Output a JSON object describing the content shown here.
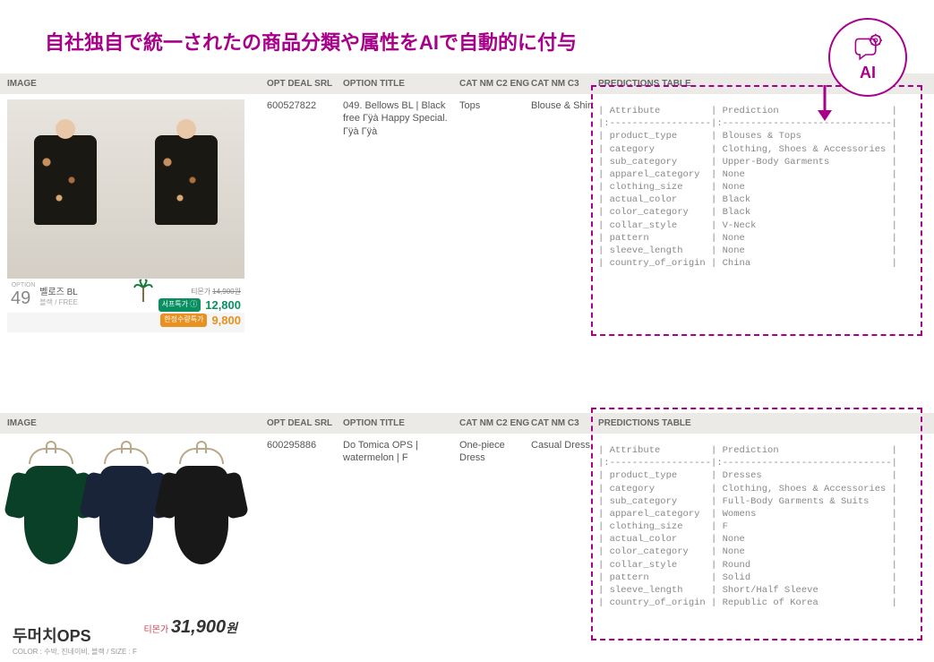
{
  "headline": "自社独自で統一されたの商品分類や属性をAIで自動的に付与",
  "ai_badge": {
    "label": "AI"
  },
  "columns": {
    "image": "IMAGE",
    "opt_deal_srl": "OPT DEAL SRL",
    "option_title": "OPTION TITLE",
    "cat_nm_c2_eng": "CAT NM C2 ENG",
    "cat_nm_c3": "CAT NM C3",
    "predictions_table": "PREDICTIONS TABLE"
  },
  "rows": [
    {
      "opt_deal_srl": "600527822",
      "option_title": "049. Bellows BL | Black free Гÿà Happy Special. Гÿà Гÿà",
      "cat_c2": "Tops",
      "cat_c3": "Blouse & Shirt",
      "product_label": {
        "prefix": "OPTION",
        "num": "49",
        "name": "벨로즈 BL",
        "sub": "블랙 / FREE"
      },
      "prices": {
        "list_label": "티몬가",
        "list": "14,900원",
        "sale_label": "서프특가 ⓘ",
        "sale": "12,800",
        "limited_label": "한정수량특가",
        "limited": "9,800"
      },
      "predictions": {
        "header_attr": "Attribute",
        "header_pred": "Prediction",
        "items": [
          {
            "attr": "product_type",
            "pred": "Blouses & Tops"
          },
          {
            "attr": "category",
            "pred": "Clothing, Shoes & Accessories"
          },
          {
            "attr": "sub_category",
            "pred": "Upper-Body Garments"
          },
          {
            "attr": "apparel_category",
            "pred": "None"
          },
          {
            "attr": "clothing_size",
            "pred": "None"
          },
          {
            "attr": "actual_color",
            "pred": "Black"
          },
          {
            "attr": "color_category",
            "pred": "Black"
          },
          {
            "attr": "collar_style",
            "pred": "V-Neck"
          },
          {
            "attr": "pattern",
            "pred": "None"
          },
          {
            "attr": "sleeve_length",
            "pred": "None"
          },
          {
            "attr": "country_of_origin",
            "pred": "China"
          }
        ]
      }
    },
    {
      "opt_deal_srl": "600295886",
      "option_title": "Do Tomica OPS | watermelon | F",
      "cat_c2": "One-piece Dress",
      "cat_c3": "Casual Dress",
      "product_label": {
        "name": "두머치OPS",
        "sub": "COLOR : 수박, 진네이비, 블랙 / SIZE : F",
        "price_label": "티몬가",
        "price": "31,900",
        "currency": "원"
      },
      "predictions": {
        "header_attr": "Attribute",
        "header_pred": "Prediction",
        "items": [
          {
            "attr": "product_type",
            "pred": "Dresses"
          },
          {
            "attr": "category",
            "pred": "Clothing, Shoes & Accessories"
          },
          {
            "attr": "sub_category",
            "pred": "Full-Body Garments & Suits"
          },
          {
            "attr": "apparel_category",
            "pred": "Womens"
          },
          {
            "attr": "clothing_size",
            "pred": "F"
          },
          {
            "attr": "actual_color",
            "pred": "None"
          },
          {
            "attr": "color_category",
            "pred": "None"
          },
          {
            "attr": "collar_style",
            "pred": "Round"
          },
          {
            "attr": "pattern",
            "pred": "Solid"
          },
          {
            "attr": "sleeve_length",
            "pred": "Short/Half Sleeve"
          },
          {
            "attr": "country_of_origin",
            "pred": "Republic of Korea"
          }
        ]
      }
    }
  ]
}
